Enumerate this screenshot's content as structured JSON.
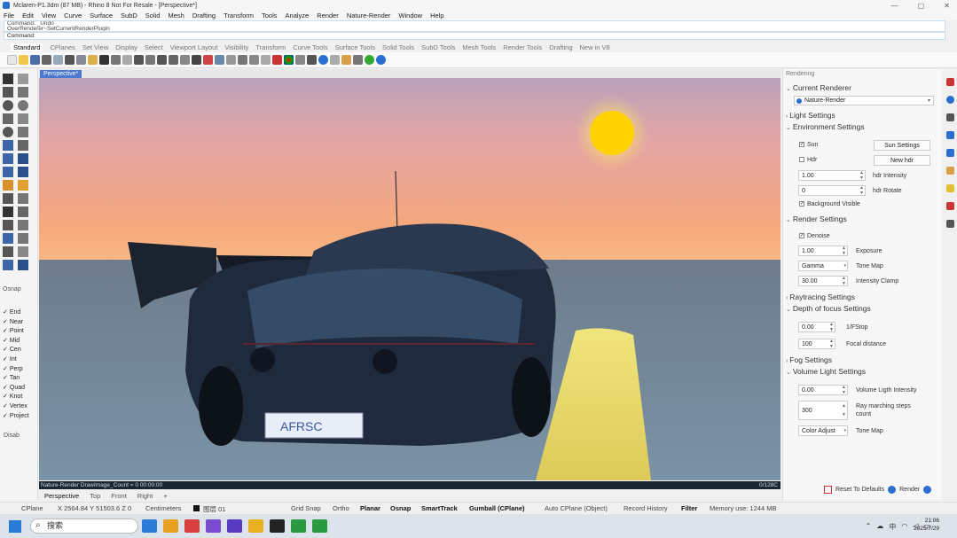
{
  "window": {
    "title": "Mclaren-P1.3dm (87 MB) - Rhino 8 Not For Resale - [Perspective*]",
    "controls": [
      "—",
      "▢",
      "✕"
    ]
  },
  "menu": [
    "File",
    "Edit",
    "View",
    "Curve",
    "Surface",
    "SubD",
    "Solid",
    "Mesh",
    "Drafting",
    "Transform",
    "Tools",
    "Analyze",
    "Render",
    "Nature-Render",
    "Window",
    "Help"
  ],
  "command": {
    "history1": "Command: _Undo",
    "history2": "OverRenderer~SetCurrentRenderPlugin",
    "prompt": "Command:"
  },
  "toolbar_tabs": [
    "Standard",
    "CPlanes",
    "Set View",
    "Display",
    "Select",
    "Viewport Layout",
    "Visibility",
    "Transform",
    "Curve Tools",
    "Surface Tools",
    "Solid Tools",
    "SubD Tools",
    "Mesh Tools",
    "Render Tools",
    "Drafting",
    "New in V8"
  ],
  "viewport": {
    "label": "Perspective*",
    "status_left": "Nature-Render   DrawImage_Count = 0   00:00:00",
    "status_right": "0/128C",
    "tabs": [
      "Perspective",
      "Top",
      "Front",
      "Right",
      "+"
    ],
    "plate": "AFRSC"
  },
  "osnap": {
    "title": "Osnap",
    "items": [
      "End",
      "Near",
      "Point",
      "Mid",
      "Cen",
      "Int",
      "Perp",
      "Tan",
      "Quad",
      "Knot",
      "Vertex",
      "Project"
    ],
    "disable": "Disab"
  },
  "rendering": {
    "panel_title": "Rendering",
    "current_renderer": "Current Renderer",
    "renderer_value": "Nature-Render",
    "light_settings": "Light Settings",
    "environment_settings": "Environment Settings",
    "sun_label": "Sun",
    "sun_settings_button": "Sun Settings",
    "hdr_label": "Hdr",
    "new_hdr_button": "New hdr",
    "hdr_intensity_value": "1.00",
    "hdr_intensity_label": "hdr Intensity",
    "hdr_rotate_value": "0",
    "hdr_rotate_label": "hdr Rotate",
    "background_visible": "Background Visible",
    "render_settings": "Render Settings",
    "denoise": "Denoise",
    "exposure_value": "1.00",
    "exposure_label": "Exposure",
    "tone_map_value": "Gamma",
    "tone_map_label": "Tone Map",
    "intensity_clamp_value": "30.00",
    "intensity_clamp_label": "Intensity Clamp",
    "raytracing_settings": "Raytracing Settings",
    "dof_settings": "Depth of focus Settings",
    "fstop_value": "0.00",
    "fstop_label": "1/FStop",
    "focal_value": "100",
    "focal_label": "Focal distance",
    "fog_settings": "Fog Settings",
    "volume_light_settings": "Volume Light Settings",
    "vol_intensity_value": "0.00",
    "vol_intensity_label": "Volume Ligth Intensity",
    "ray_steps_value": "300",
    "ray_steps_label": "Ray marching steps count",
    "vol_tonemap_value": "Color Adjust",
    "vol_tonemap_label": "Tone Map",
    "reset_button": "Reset To Defaults",
    "render_button": "Render"
  },
  "statusbar": {
    "cplane": "CPlane",
    "coords": "X 2564.84 Y 51503.6 Z 0",
    "units": "Centimeters",
    "layer": "图层 01",
    "grid_snap": "Grid Snap",
    "ortho": "Ortho",
    "planar": "Planar",
    "osnap": "Osnap",
    "smarttrack": "SmartTrack",
    "gumball": "Gumball (CPlane)",
    "autocplane": "Auto CPlane (Object)",
    "record": "Record History",
    "filter": "Filter",
    "memory": "Memory use: 1244 MB"
  },
  "taskbar": {
    "search": "搜索",
    "tray_lang": "中",
    "time": "21:06",
    "date": "2025/7/29"
  },
  "colors": {
    "accent": "#2a6fd0",
    "sun": "#ffd200",
    "sky_top": "#c9a5b8",
    "sky_horizon": "#f4a47a",
    "sea": "#6d8294"
  }
}
